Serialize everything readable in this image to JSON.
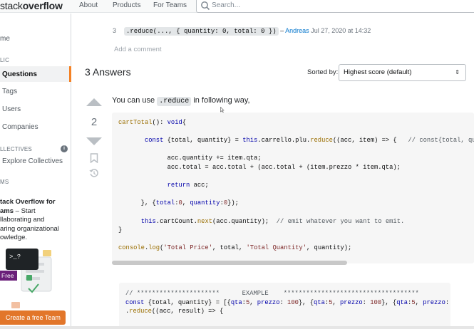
{
  "header": {
    "logo_prefix": "stack",
    "logo_bold": "overflow",
    "nav": [
      "About",
      "Products",
      "For Teams"
    ],
    "search_placeholder": "Search..."
  },
  "sidebar": {
    "home": "me",
    "public_section": "LIC",
    "questions": "Questions",
    "tags": "Tags",
    "users": "Users",
    "companies": "Companies",
    "collectives_section": "LLECTIVES",
    "explore_collectives": "Explore Collectives",
    "teams_section": "MS",
    "promo_bold": "tack Overflow for\nams",
    "promo_rest": " – Start\nllaborating and\naring organizational\nowledge.",
    "free_badge": "Free",
    "cta": "Create a free Team"
  },
  "comment": {
    "number": "3",
    "code": ".reduce(..., { quantity: 0, total: 0 })",
    "separator": " – ",
    "user": "Andreas",
    "date": " Jul 27, 2020 at 14:32"
  },
  "add_comment": "Add a comment",
  "answers": {
    "title": "3 Answers",
    "sorted_by_label": "Sorted by:",
    "sort_value": "Highest score (default)"
  },
  "answer": {
    "score": "2",
    "text_before": "You can use ",
    "inline_code": ".reduce",
    "text_after": " in following way,"
  },
  "colors": {
    "accent": "#f48225",
    "link": "#0074cc",
    "cta": "#e2762a"
  },
  "icons": [
    "search-icon",
    "vote-up-icon",
    "vote-down-icon",
    "bookmark-icon",
    "history-icon",
    "info-icon"
  ]
}
